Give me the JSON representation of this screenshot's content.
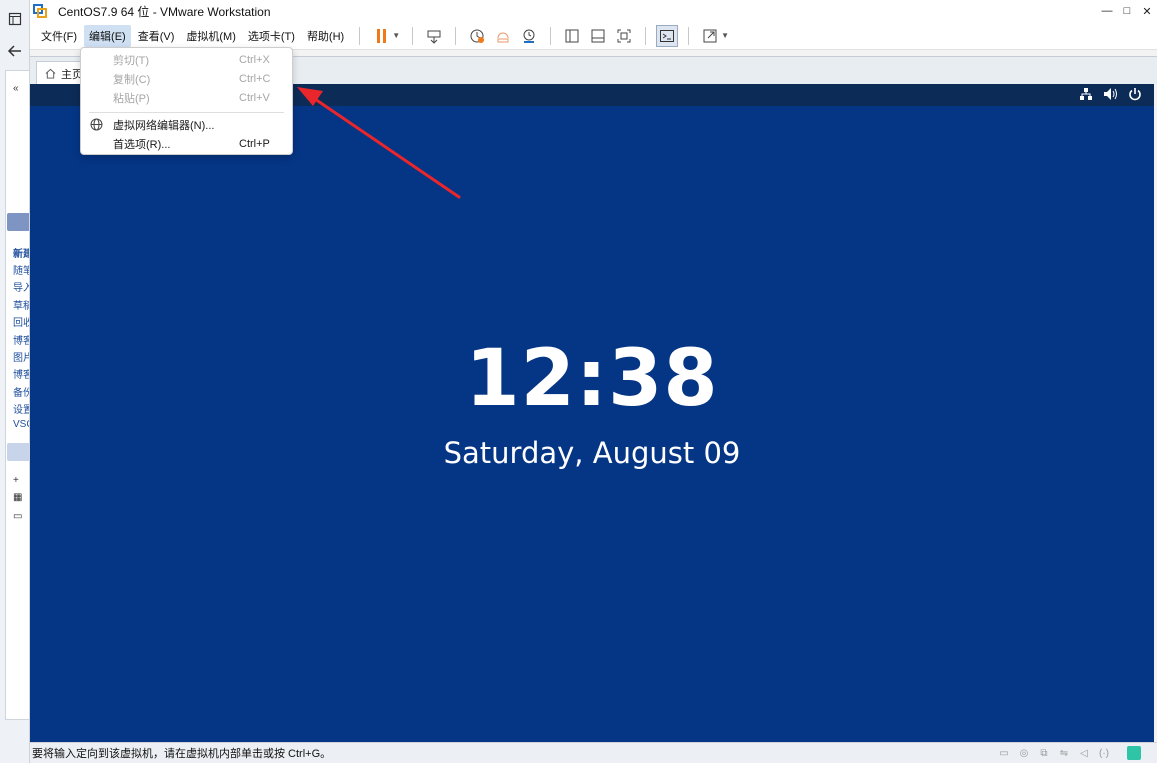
{
  "window": {
    "title": "CentOS7.9 64 位 - VMware Workstation",
    "controls": [
      "minimize",
      "maximize",
      "close"
    ]
  },
  "menubar": {
    "items": [
      {
        "label": "文件(F)"
      },
      {
        "label": "编辑(E)",
        "active": true
      },
      {
        "label": "查看(V)"
      },
      {
        "label": "虚拟机(M)"
      },
      {
        "label": "选项卡(T)"
      },
      {
        "label": "帮助(H)"
      }
    ]
  },
  "toolbar": {
    "icons": [
      "pause-icon",
      "send-keys-icon",
      "snapshot-icon",
      "revert-snapshot-icon",
      "snapshot-manager-icon",
      "library-view-icon",
      "thumbnail-view-icon",
      "full-screen-icon",
      "console-icon",
      "unity-icon"
    ],
    "accent_pause": "#f07a1a"
  },
  "tabs": [
    {
      "label": "主页",
      "icon": "home-icon"
    }
  ],
  "edit_menu": {
    "items": [
      {
        "label": "剪切(T)",
        "shortcut": "Ctrl+X",
        "enabled": false
      },
      {
        "label": "复制(C)",
        "shortcut": "Ctrl+C",
        "enabled": false
      },
      {
        "label": "粘贴(P)",
        "shortcut": "Ctrl+V",
        "enabled": false
      },
      {
        "label": "虚拟网络编辑器(N)...",
        "shortcut": "",
        "enabled": true,
        "icon": "globe-icon"
      },
      {
        "label": "首选项(R)...",
        "shortcut": "Ctrl+P",
        "enabled": true
      }
    ]
  },
  "library": {
    "collapse": "«",
    "items": [
      "新建",
      "随笔",
      "导入",
      "草稿",
      "回收",
      "博客",
      "图片",
      "博客",
      "备份",
      "设置",
      "VSC"
    ]
  },
  "vm_screen": {
    "time": "12:38",
    "date": "Saturday, August 09",
    "background": "#053585",
    "topbar_icons": [
      "network-icon",
      "volume-icon",
      "power-icon"
    ]
  },
  "statusbar": {
    "text": "要将输入定向到该虚拟机，请在虚拟机内部单击或按 Ctrl+G。"
  },
  "annotation": {
    "arrow_color": "#e8262b"
  }
}
